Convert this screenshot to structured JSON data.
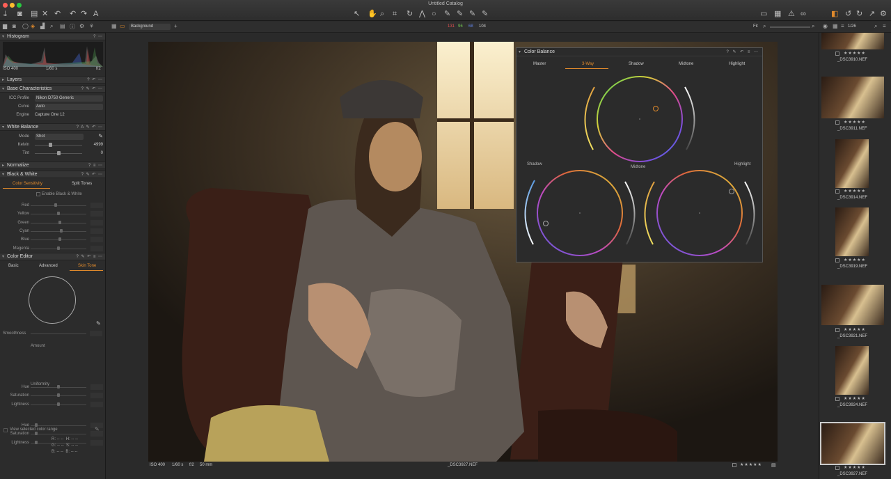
{
  "window": {
    "title": "Untitled Catalog"
  },
  "toolbar2": {
    "background_select": "Background",
    "rgb_r": "131",
    "rgb_g": "96",
    "rgb_b": "68",
    "rgb_k": "104",
    "zoom_label": "Fit"
  },
  "histogram": {
    "title": "Histogram",
    "iso": "ISO 400",
    "shutter": "1/60 s",
    "aperture": "f/2"
  },
  "sections": {
    "layers": "Layers",
    "base": "Base Characteristics",
    "white_balance": "White Balance",
    "normalize": "Normalize",
    "black_white": "Black & White",
    "color_editor": "Color Editor"
  },
  "base": {
    "icc_label": "ICC Profile",
    "icc_value": "Nikon D750 Generic",
    "curve_label": "Curve",
    "curve_value": "Auto",
    "engine_label": "Engine",
    "engine_value": "Capture One 12"
  },
  "wb": {
    "mode_label": "Mode",
    "mode_value": "Shot",
    "kelvin_label": "Kelvin",
    "kelvin_value": "4999",
    "tint_label": "Tint",
    "tint_value": "0"
  },
  "bw": {
    "tab1": "Color Sensitivity",
    "tab2": "Split Tones",
    "enable": "Enable Black & White",
    "rows": [
      "Red",
      "Yellow",
      "Green",
      "Cyan",
      "Blue",
      "Magenta"
    ]
  },
  "ce": {
    "tab1": "Basic",
    "tab2": "Advanced",
    "tab3": "Skin Tone",
    "smoothness": "Smoothness",
    "amount": "Amount",
    "uniformity": "Uniformity",
    "hue": "Hue",
    "saturation": "Saturation",
    "lightness": "Lightness",
    "view_range": "View selected color range",
    "readout_r": "R:",
    "readout_g": "G:",
    "readout_b": "B:",
    "readout_h": "H:",
    "readout_s": "S:",
    "readout_bb": "B:",
    "dash": "--"
  },
  "status": {
    "iso": "ISO 400",
    "shutter": "1/60 s",
    "aperture": "f/2",
    "focal": "50 mm",
    "filename": "_DSC3927.NEF"
  },
  "browser": {
    "count": "1/26",
    "items": [
      "_DSC3910.NEF",
      "_DSC3911.NEF",
      "_DSC3914.NEF",
      "_DSC3919.NEF",
      "_DSC3921.NEF",
      "_DSC3924.NEF",
      "_DSC3927.NEF"
    ],
    "stars": "★★★★★"
  },
  "color_balance": {
    "title": "Color Balance",
    "tabs": [
      "Master",
      "3-Way",
      "Shadow",
      "Midtone",
      "Highlight"
    ],
    "labels": {
      "shadow": "Shadow",
      "midtone": "Midtone",
      "highlight": "Highlight"
    }
  },
  "accent_color": "#e08a2c"
}
